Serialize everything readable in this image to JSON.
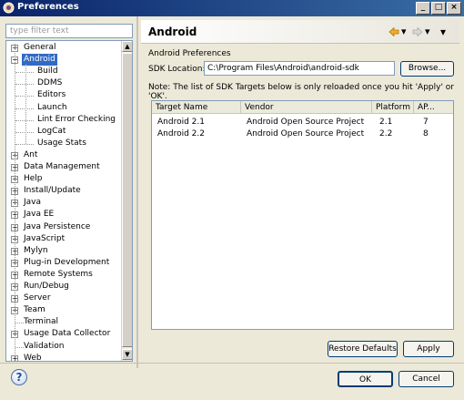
{
  "window": {
    "title": "Preferences",
    "buttons": [
      "_",
      "□",
      "×"
    ]
  },
  "filter": {
    "placeholder": "type filter text"
  },
  "tree": {
    "items": [
      {
        "label": "General",
        "expander": "+",
        "selected": false
      },
      {
        "label": "Android",
        "expander": "−",
        "selected": true
      },
      {
        "label": "Build",
        "expander": "",
        "selected": false
      },
      {
        "label": "DDMS",
        "expander": "",
        "selected": false
      },
      {
        "label": "Editors",
        "expander": "",
        "selected": false
      },
      {
        "label": "Launch",
        "expander": "",
        "selected": false
      },
      {
        "label": "Lint Error Checking",
        "expander": "",
        "selected": false
      },
      {
        "label": "LogCat",
        "expander": "",
        "selected": false
      },
      {
        "label": "Usage Stats",
        "expander": "",
        "selected": false
      },
      {
        "label": "Ant",
        "expander": "+",
        "selected": false
      },
      {
        "label": "Data Management",
        "expander": "+",
        "selected": false
      },
      {
        "label": "Help",
        "expander": "+",
        "selected": false
      },
      {
        "label": "Install/Update",
        "expander": "+",
        "selected": false
      },
      {
        "label": "Java",
        "expander": "+",
        "selected": false
      },
      {
        "label": "Java EE",
        "expander": "+",
        "selected": false
      },
      {
        "label": "Java Persistence",
        "expander": "+",
        "selected": false
      },
      {
        "label": "JavaScript",
        "expander": "+",
        "selected": false
      },
      {
        "label": "Mylyn",
        "expander": "+",
        "selected": false
      },
      {
        "label": "Plug-in Development",
        "expander": "+",
        "selected": false
      },
      {
        "label": "Remote Systems",
        "expander": "+",
        "selected": false
      },
      {
        "label": "Run/Debug",
        "expander": "+",
        "selected": false
      },
      {
        "label": "Server",
        "expander": "+",
        "selected": false
      },
      {
        "label": "Team",
        "expander": "+",
        "selected": false
      },
      {
        "label": "Terminal",
        "expander": "",
        "selected": false
      },
      {
        "label": "Usage Data Collector",
        "expander": "+",
        "selected": false
      },
      {
        "label": "Validation",
        "expander": "",
        "selected": false
      },
      {
        "label": "Web",
        "expander": "+",
        "selected": false
      }
    ]
  },
  "page": {
    "title": "Android",
    "section_label": "Android Preferences",
    "sdk_label": "SDK Location:",
    "sdk_value": "C:\\Program Files\\Android\\android-sdk",
    "browse_label": "Browse...",
    "note": "Note: The list of SDK Targets below is only reloaded once you hit 'Apply' or 'OK'.",
    "nav_icons": [
      "back-arrow-icon",
      "forward-arrow-icon",
      "menu-icon"
    ]
  },
  "targets": {
    "columns": [
      "Target Name",
      "Vendor",
      "Platform",
      "AP..."
    ],
    "rows": [
      [
        "Android 2.1",
        "Android Open Source Project",
        "2.1",
        "7"
      ],
      [
        "Android 2.2",
        "Android Open Source Project",
        "2.2",
        "8"
      ]
    ]
  },
  "buttons": {
    "restore_defaults": "Restore Defaults",
    "apply": "Apply",
    "ok": "OK",
    "cancel": "Cancel",
    "help": "?"
  },
  "colors": {
    "selection": "#316ac5",
    "titlebar": "#0a246a",
    "nav_arrow": "#f0b020"
  }
}
